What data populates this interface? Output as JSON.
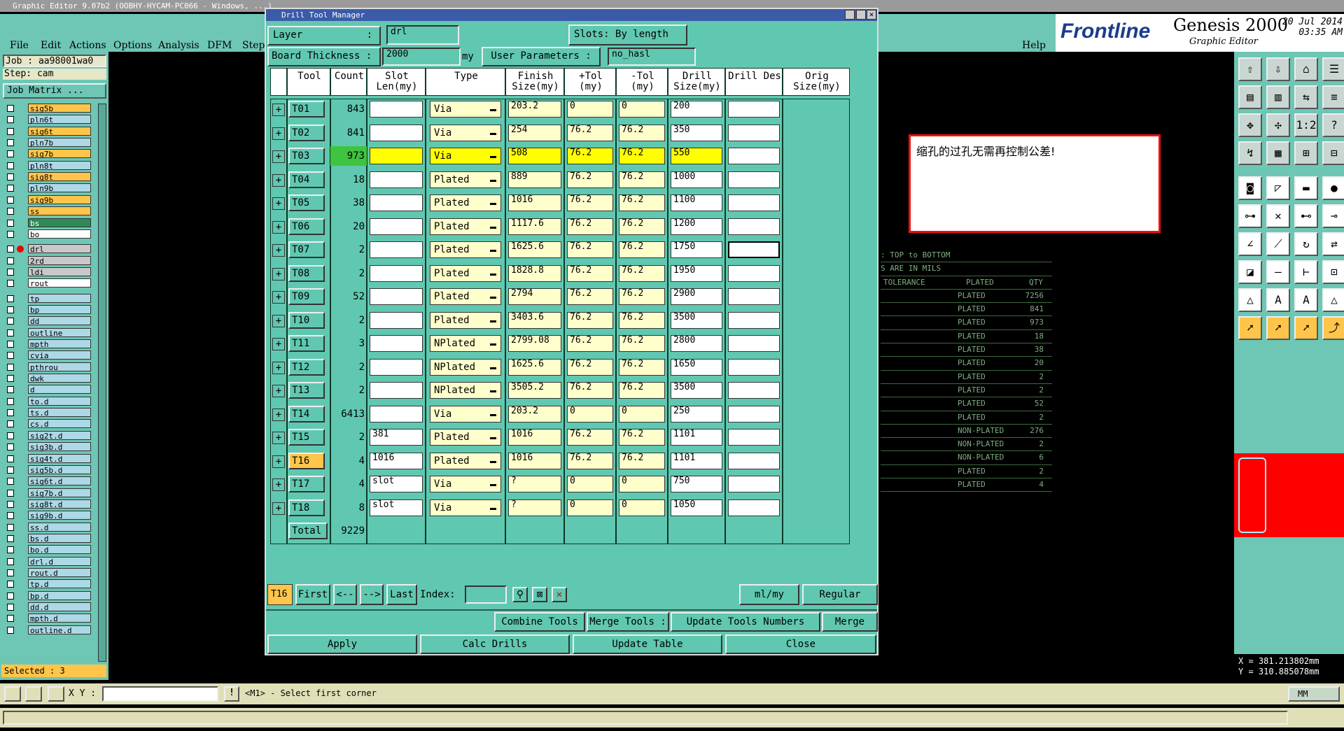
{
  "app": {
    "title": "Graphic Editor 9.07b2 (OOBHY-HYCAM-PC066 - Windows, ...)",
    "menu": [
      "File",
      "Edit",
      "Actions",
      "Options",
      "Analysis",
      "DFM",
      "Step"
    ],
    "help": "Help",
    "brand": "Frontline",
    "product": "Genesis 2000",
    "subproduct": "Graphic Editor",
    "date": "20 Jul 2014",
    "time": "03:35 AM"
  },
  "left": {
    "job": "Job : aa98001wa0",
    "step": "Step: cam",
    "matrix": "Job Matrix ...",
    "selected": "Selected : 3",
    "layers": [
      {
        "n": "sig5b",
        "c": "or"
      },
      {
        "n": "pln6t",
        "c": ""
      },
      {
        "n": "sig6t",
        "c": "or"
      },
      {
        "n": "pln7b",
        "c": ""
      },
      {
        "n": "sig7b",
        "c": "or"
      },
      {
        "n": "pln8t",
        "c": ""
      },
      {
        "n": "sig8t",
        "c": "or"
      },
      {
        "n": "pln9b",
        "c": ""
      },
      {
        "n": "sig9b",
        "c": "or"
      },
      {
        "n": "ss",
        "c": "or"
      },
      {
        "n": "bs",
        "c": "gr"
      },
      {
        "n": "bo",
        "c": "wh"
      },
      {
        "n": "drl",
        "c": "gy"
      },
      {
        "n": "2rd",
        "c": "gy"
      },
      {
        "n": "ldi",
        "c": "gy"
      },
      {
        "n": "rout",
        "c": "wh"
      },
      {
        "n": "tp",
        "c": ""
      },
      {
        "n": "bp",
        "c": ""
      },
      {
        "n": "dd",
        "c": ""
      },
      {
        "n": "outline",
        "c": ""
      },
      {
        "n": "mpth",
        "c": ""
      },
      {
        "n": "cvia",
        "c": ""
      },
      {
        "n": "pthrou",
        "c": ""
      },
      {
        "n": "dwk",
        "c": ""
      },
      {
        "n": "d",
        "c": ""
      },
      {
        "n": "to.d",
        "c": ""
      },
      {
        "n": "ts.d",
        "c": ""
      },
      {
        "n": "cs.d",
        "c": ""
      },
      {
        "n": "sig2t.d",
        "c": ""
      },
      {
        "n": "sig3b.d",
        "c": ""
      },
      {
        "n": "sig4t.d",
        "c": ""
      },
      {
        "n": "sig5b.d",
        "c": ""
      },
      {
        "n": "sig6t.d",
        "c": ""
      },
      {
        "n": "sig7b.d",
        "c": ""
      },
      {
        "n": "sig8t.d",
        "c": ""
      },
      {
        "n": "sig9b.d",
        "c": ""
      },
      {
        "n": "ss.d",
        "c": ""
      },
      {
        "n": "bs.d",
        "c": ""
      },
      {
        "n": "bo.d",
        "c": ""
      },
      {
        "n": "drl.d",
        "c": ""
      },
      {
        "n": "rout.d",
        "c": ""
      },
      {
        "n": "tp.d",
        "c": ""
      },
      {
        "n": "bp.d",
        "c": ""
      },
      {
        "n": "dd.d",
        "c": ""
      },
      {
        "n": "mpth.d",
        "c": ""
      },
      {
        "n": "outline.d",
        "c": ""
      }
    ]
  },
  "note": "缩孔的过孔无需再控制公差!",
  "bgtable": {
    "header1": ": TOP to BOTTOM",
    "header2": "S ARE IN MILS",
    "cols": [
      "TOLERANCE",
      "PLATED",
      "QTY"
    ],
    "rows": [
      [
        "PLATED",
        "7256"
      ],
      [
        "PLATED",
        "841"
      ],
      [
        "PLATED",
        "973"
      ],
      [
        "PLATED",
        "18"
      ],
      [
        "PLATED",
        "38"
      ],
      [
        "PLATED",
        "20"
      ],
      [
        "PLATED",
        "2"
      ],
      [
        "PLATED",
        "2"
      ],
      [
        "PLATED",
        "52"
      ],
      [
        "PLATED",
        "2"
      ],
      [
        "NON-PLATED",
        "276"
      ],
      [
        "NON-PLATED",
        "2"
      ],
      [
        "NON-PLATED",
        "6"
      ],
      [
        "PLATED",
        "2"
      ],
      [
        "PLATED",
        "4"
      ]
    ]
  },
  "coords": {
    "x": "X = 381.213802mm",
    "y": "Y = 310.885078mm"
  },
  "bottom": {
    "xy_label": "X Y :",
    "prompt": "<M1> - Select first corner",
    "units": "MM"
  },
  "dlg": {
    "title": "Drill Tool Manager",
    "layer_label": "Layer",
    "layer": "drl",
    "slots_label": "Slots:",
    "slots": "By length",
    "thick_label": "Board Thickness :",
    "thick": "2000",
    "thick_unit": "my",
    "userparams_label": "User Parameters :",
    "userparams": "no_hasl",
    "headers": [
      "Tool",
      "Count",
      "Slot Len(my)",
      "Type",
      "Finish Size(my)",
      "+Tol (my)",
      "-Tol (my)",
      "Drill Size(my)",
      "Drill Des",
      "Orig Size(my)"
    ],
    "rows": [
      {
        "t": "T01",
        "c": "843",
        "s": "",
        "ty": "Via",
        "f": "203.2",
        "p": "0",
        "m": "0",
        "d": "200"
      },
      {
        "t": "T02",
        "c": "841",
        "s": "",
        "ty": "Via",
        "f": "254",
        "p": "76.2",
        "m": "76.2",
        "d": "350"
      },
      {
        "t": "T03",
        "c": "973",
        "s": "",
        "ty": "Via",
        "f": "508",
        "p": "76.2",
        "m": "76.2",
        "d": "550"
      },
      {
        "t": "T04",
        "c": "18",
        "s": "",
        "ty": "Plated",
        "f": "889",
        "p": "76.2",
        "m": "76.2",
        "d": "1000"
      },
      {
        "t": "T05",
        "c": "38",
        "s": "",
        "ty": "Plated",
        "f": "1016",
        "p": "76.2",
        "m": "76.2",
        "d": "1100"
      },
      {
        "t": "T06",
        "c": "20",
        "s": "",
        "ty": "Plated",
        "f": "1117.6",
        "p": "76.2",
        "m": "76.2",
        "d": "1200"
      },
      {
        "t": "T07",
        "c": "2",
        "s": "",
        "ty": "Plated",
        "f": "1625.6",
        "p": "76.2",
        "m": "76.2",
        "d": "1750"
      },
      {
        "t": "T08",
        "c": "2",
        "s": "",
        "ty": "Plated",
        "f": "1828.8",
        "p": "76.2",
        "m": "76.2",
        "d": "1950"
      },
      {
        "t": "T09",
        "c": "52",
        "s": "",
        "ty": "Plated",
        "f": "2794",
        "p": "76.2",
        "m": "76.2",
        "d": "2900"
      },
      {
        "t": "T10",
        "c": "2",
        "s": "",
        "ty": "Plated",
        "f": "3403.6",
        "p": "76.2",
        "m": "76.2",
        "d": "3500"
      },
      {
        "t": "T11",
        "c": "3",
        "s": "",
        "ty": "NPlated",
        "f": "2799.08",
        "p": "76.2",
        "m": "76.2",
        "d": "2800"
      },
      {
        "t": "T12",
        "c": "2",
        "s": "",
        "ty": "NPlated",
        "f": "1625.6",
        "p": "76.2",
        "m": "76.2",
        "d": "1650"
      },
      {
        "t": "T13",
        "c": "2",
        "s": "",
        "ty": "NPlated",
        "f": "3505.2",
        "p": "76.2",
        "m": "76.2",
        "d": "3500"
      },
      {
        "t": "T14",
        "c": "6413",
        "s": "",
        "ty": "Via",
        "f": "203.2",
        "p": "0",
        "m": "0",
        "d": "250"
      },
      {
        "t": "T15",
        "c": "2",
        "s": "381",
        "ty": "Plated",
        "f": "1016",
        "p": "76.2",
        "m": "76.2",
        "d": "1101"
      },
      {
        "t": "T16",
        "c": "4",
        "s": "1016",
        "ty": "Plated",
        "f": "1016",
        "p": "76.2",
        "m": "76.2",
        "d": "1101"
      },
      {
        "t": "T17",
        "c": "4",
        "s": "slot",
        "ty": "Via",
        "f": "?",
        "p": "0",
        "m": "0",
        "d": "750"
      },
      {
        "t": "T18",
        "c": "8",
        "s": "slot",
        "ty": "Via",
        "f": "?",
        "p": "0",
        "m": "0",
        "d": "1050"
      }
    ],
    "total_label": "Total",
    "total": "9229",
    "nav": {
      "current": "T16",
      "first": "First",
      "prev": "<--",
      "next": "-->",
      "last": "Last",
      "index": "Index:",
      "units": "ml/my",
      "mode": "Regular"
    },
    "buttons": {
      "combine": "Combine Tools",
      "merge_tools": "Merge Tools :",
      "update_nums": "Update Tools Numbers",
      "merge": "Merge",
      "apply": "Apply",
      "calc": "Calc Drills",
      "update": "Update Table",
      "close": "Close"
    }
  }
}
